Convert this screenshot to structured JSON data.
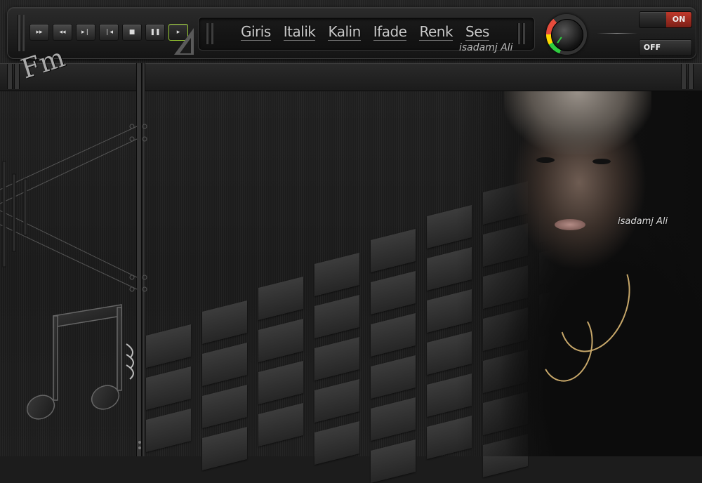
{
  "menu": {
    "items": [
      "Giris",
      "Italik",
      "Kalin",
      "Ifade",
      "Renk",
      "Ses"
    ],
    "signature": "isadamj Ali"
  },
  "player": {
    "controls": [
      {
        "name": "fast-forward",
        "glyph": "▸▸"
      },
      {
        "name": "rewind",
        "glyph": "◂◂"
      },
      {
        "name": "skip-forward",
        "glyph": "▸❘"
      },
      {
        "name": "skip-back",
        "glyph": "❘◂"
      },
      {
        "name": "stop",
        "glyph": "■"
      },
      {
        "name": "pause",
        "glyph": "❚❚"
      },
      {
        "name": "play",
        "glyph": "▸"
      }
    ]
  },
  "toggles": {
    "on_label": "ON",
    "off_label": "OFF"
  },
  "logo": {
    "text": "Fm"
  },
  "photo": {
    "signature": "isadamj Ali"
  },
  "colors": {
    "accent_on": "#c0392b",
    "play_border": "#9acd32",
    "knob_green": "#2ecc40"
  }
}
